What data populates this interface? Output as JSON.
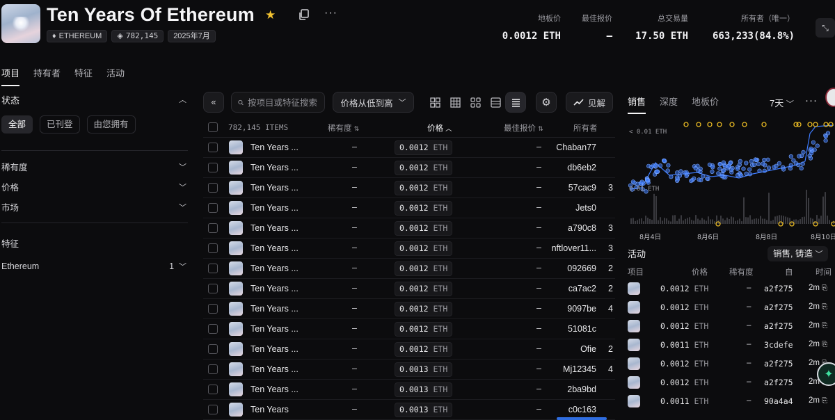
{
  "collection": {
    "title": "Ten Years Of Ethereum",
    "chain": "ETHEREUM",
    "supply": "782,145",
    "date": "2025年7月"
  },
  "stats": [
    {
      "label": "地板价",
      "value": "0.0012 ETH"
    },
    {
      "label": "最佳报价",
      "value": "–"
    },
    {
      "label": "总交易量",
      "value": "17.50 ETH"
    },
    {
      "label": "所有者（唯一）",
      "value": "663,233(84.8%)"
    }
  ],
  "tabs": [
    "项目",
    "持有者",
    "特征",
    "活动"
  ],
  "sidebar": {
    "status_title": "状态",
    "status_pills": [
      "全部",
      "已刊登",
      "由您拥有"
    ],
    "filters": [
      "稀有度",
      "价格",
      "市场"
    ],
    "traits_title": "特征",
    "trait_name": "Ethereum",
    "trait_count": "1"
  },
  "toolbar": {
    "search_placeholder": "按项目或特征搜索",
    "sort_label": "价格从低到高",
    "insights_label": "见解"
  },
  "table": {
    "headers": {
      "items": "782,145 ITEMS",
      "rarity": "稀有度",
      "price": "价格",
      "best_offer": "最佳报价",
      "owner": "所有者"
    },
    "rows": [
      {
        "name": "Ten Years ...",
        "rarity": "–",
        "price": "0.0012",
        "unit": "ETH",
        "bid": "–",
        "owner": "Chaban77",
        "extra": ""
      },
      {
        "name": "Ten Years ...",
        "rarity": "–",
        "price": "0.0012",
        "unit": "ETH",
        "bid": "–",
        "owner": "db6eb2",
        "extra": ""
      },
      {
        "name": "Ten Years ...",
        "rarity": "–",
        "price": "0.0012",
        "unit": "ETH",
        "bid": "–",
        "owner": "57cac9",
        "extra": "3"
      },
      {
        "name": "Ten Years ...",
        "rarity": "–",
        "price": "0.0012",
        "unit": "ETH",
        "bid": "–",
        "owner": "Jets0",
        "extra": ""
      },
      {
        "name": "Ten Years ...",
        "rarity": "–",
        "price": "0.0012",
        "unit": "ETH",
        "bid": "–",
        "owner": "a790c8",
        "extra": "3"
      },
      {
        "name": "Ten Years ...",
        "rarity": "–",
        "price": "0.0012",
        "unit": "ETH",
        "bid": "–",
        "owner": "nftlover11...",
        "extra": "3"
      },
      {
        "name": "Ten Years ...",
        "rarity": "–",
        "price": "0.0012",
        "unit": "ETH",
        "bid": "–",
        "owner": "092669",
        "extra": "2"
      },
      {
        "name": "Ten Years ...",
        "rarity": "–",
        "price": "0.0012",
        "unit": "ETH",
        "bid": "–",
        "owner": "ca7ac2",
        "extra": "2"
      },
      {
        "name": "Ten Years ...",
        "rarity": "–",
        "price": "0.0012",
        "unit": "ETH",
        "bid": "–",
        "owner": "9097be",
        "extra": "4"
      },
      {
        "name": "Ten Years ...",
        "rarity": "–",
        "price": "0.0012",
        "unit": "ETH",
        "bid": "–",
        "owner": "51081c",
        "extra": ""
      },
      {
        "name": "Ten Years ...",
        "rarity": "–",
        "price": "0.0012",
        "unit": "ETH",
        "bid": "–",
        "owner": "Ofie",
        "extra": "2"
      },
      {
        "name": "Ten Years ...",
        "rarity": "–",
        "price": "0.0013",
        "unit": "ETH",
        "bid": "–",
        "owner": "Mj12345",
        "extra": "4"
      },
      {
        "name": "Ten Years ...",
        "rarity": "–",
        "price": "0.0013",
        "unit": "ETH",
        "bid": "–",
        "owner": "2ba9bd",
        "extra": ""
      },
      {
        "name": "Ten Years",
        "rarity": "–",
        "price": "0.0013",
        "unit": "ETH",
        "bid": "–",
        "owner": "c0c163",
        "extra": ""
      }
    ]
  },
  "right_panel": {
    "tabs": [
      "销售",
      "深度",
      "地板价"
    ],
    "range": "7天",
    "activity_title": "活动",
    "activity_filter": "销售, 铸造",
    "activity_headers": [
      "项目",
      "价格",
      "稀有度",
      "自",
      "时间"
    ],
    "activity_rows": [
      {
        "price": "0.0012",
        "unit": "ETH",
        "rarity": "–",
        "from": "a2f275",
        "time": "2m"
      },
      {
        "price": "0.0012",
        "unit": "ETH",
        "rarity": "–",
        "from": "a2f275",
        "time": "2m"
      },
      {
        "price": "0.0012",
        "unit": "ETH",
        "rarity": "–",
        "from": "a2f275",
        "time": "2m"
      },
      {
        "price": "0.0011",
        "unit": "ETH",
        "rarity": "–",
        "from": "3cdefe",
        "time": "2m"
      },
      {
        "price": "0.0012",
        "unit": "ETH",
        "rarity": "–",
        "from": "a2f275",
        "time": "2m"
      },
      {
        "price": "0.0012",
        "unit": "ETH",
        "rarity": "–",
        "from": "a2f275",
        "time": "2m"
      },
      {
        "price": "0.0011",
        "unit": "ETH",
        "rarity": "–",
        "from": "90a4a4",
        "time": "2m"
      }
    ]
  },
  "chart_data": {
    "type": "scatter",
    "y_tick_labels": [
      "< 0.01 ETH",
      "0.01 ETH"
    ],
    "x_tick_labels": [
      "8月4日",
      "8月6日",
      "8月8日",
      "8月10日"
    ],
    "accent_color": "#3d7bff",
    "offer_color": "#e8b923"
  },
  "colors": {
    "accent": "#3d7bff",
    "star": "#f4c431",
    "background": "#0c0c0e"
  }
}
